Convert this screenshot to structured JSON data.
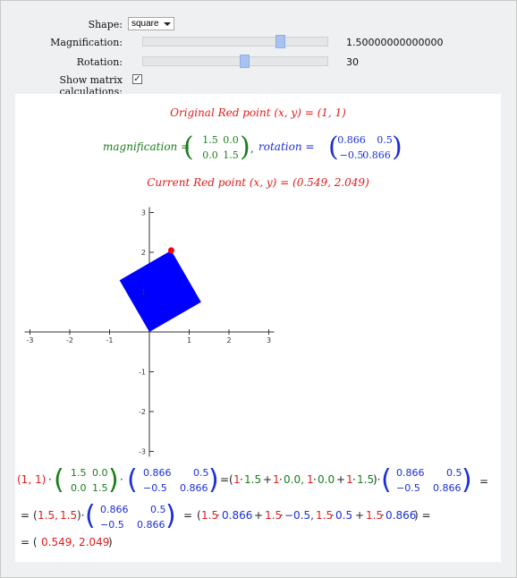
{
  "controls": {
    "shape_label": "Shape:",
    "shape_value": "square",
    "magnification_label": "Magnification:",
    "magnification_value": "1.50000000000000",
    "magnification_pos": 0.75,
    "rotation_label": "Rotation:",
    "rotation_value": "30",
    "rotation_pos": 0.55,
    "show_matrix_label": "Show matrix calculations:",
    "show_matrix_checked": true
  },
  "output": {
    "original_point": "Original Red point (x, y) = (1, 1)",
    "mag_prefix": "magnification =",
    "mag_matrix": [
      "1.5",
      "0.0",
      "0.0",
      "1.5"
    ],
    "rot_prefix": "rotation =",
    "rot_matrix": [
      "0.866",
      "0.5",
      "−0.5",
      "0.866"
    ],
    "current_point": "Current Red point (x, y) = (0.549, 2.049)",
    "calc_line3": "= (0.549,  2.049)"
  },
  "chart_data": {
    "type": "scatter",
    "xlim": [
      -3,
      3
    ],
    "ylim": [
      -3,
      3
    ],
    "xticks": [
      "-3",
      "-2",
      "-1",
      "1",
      "2",
      "3"
    ],
    "yticks": [
      "3",
      "2",
      "1",
      "-1",
      "-2",
      "-3"
    ],
    "shape_vertices": [
      [
        0,
        0
      ],
      [
        1.299,
        0.75
      ],
      [
        0.549,
        2.049
      ],
      [
        -0.75,
        1.299
      ]
    ],
    "shape_color": "#0000ff",
    "red_point": [
      0.549,
      2.049
    ],
    "red_color": "#ff0000"
  }
}
